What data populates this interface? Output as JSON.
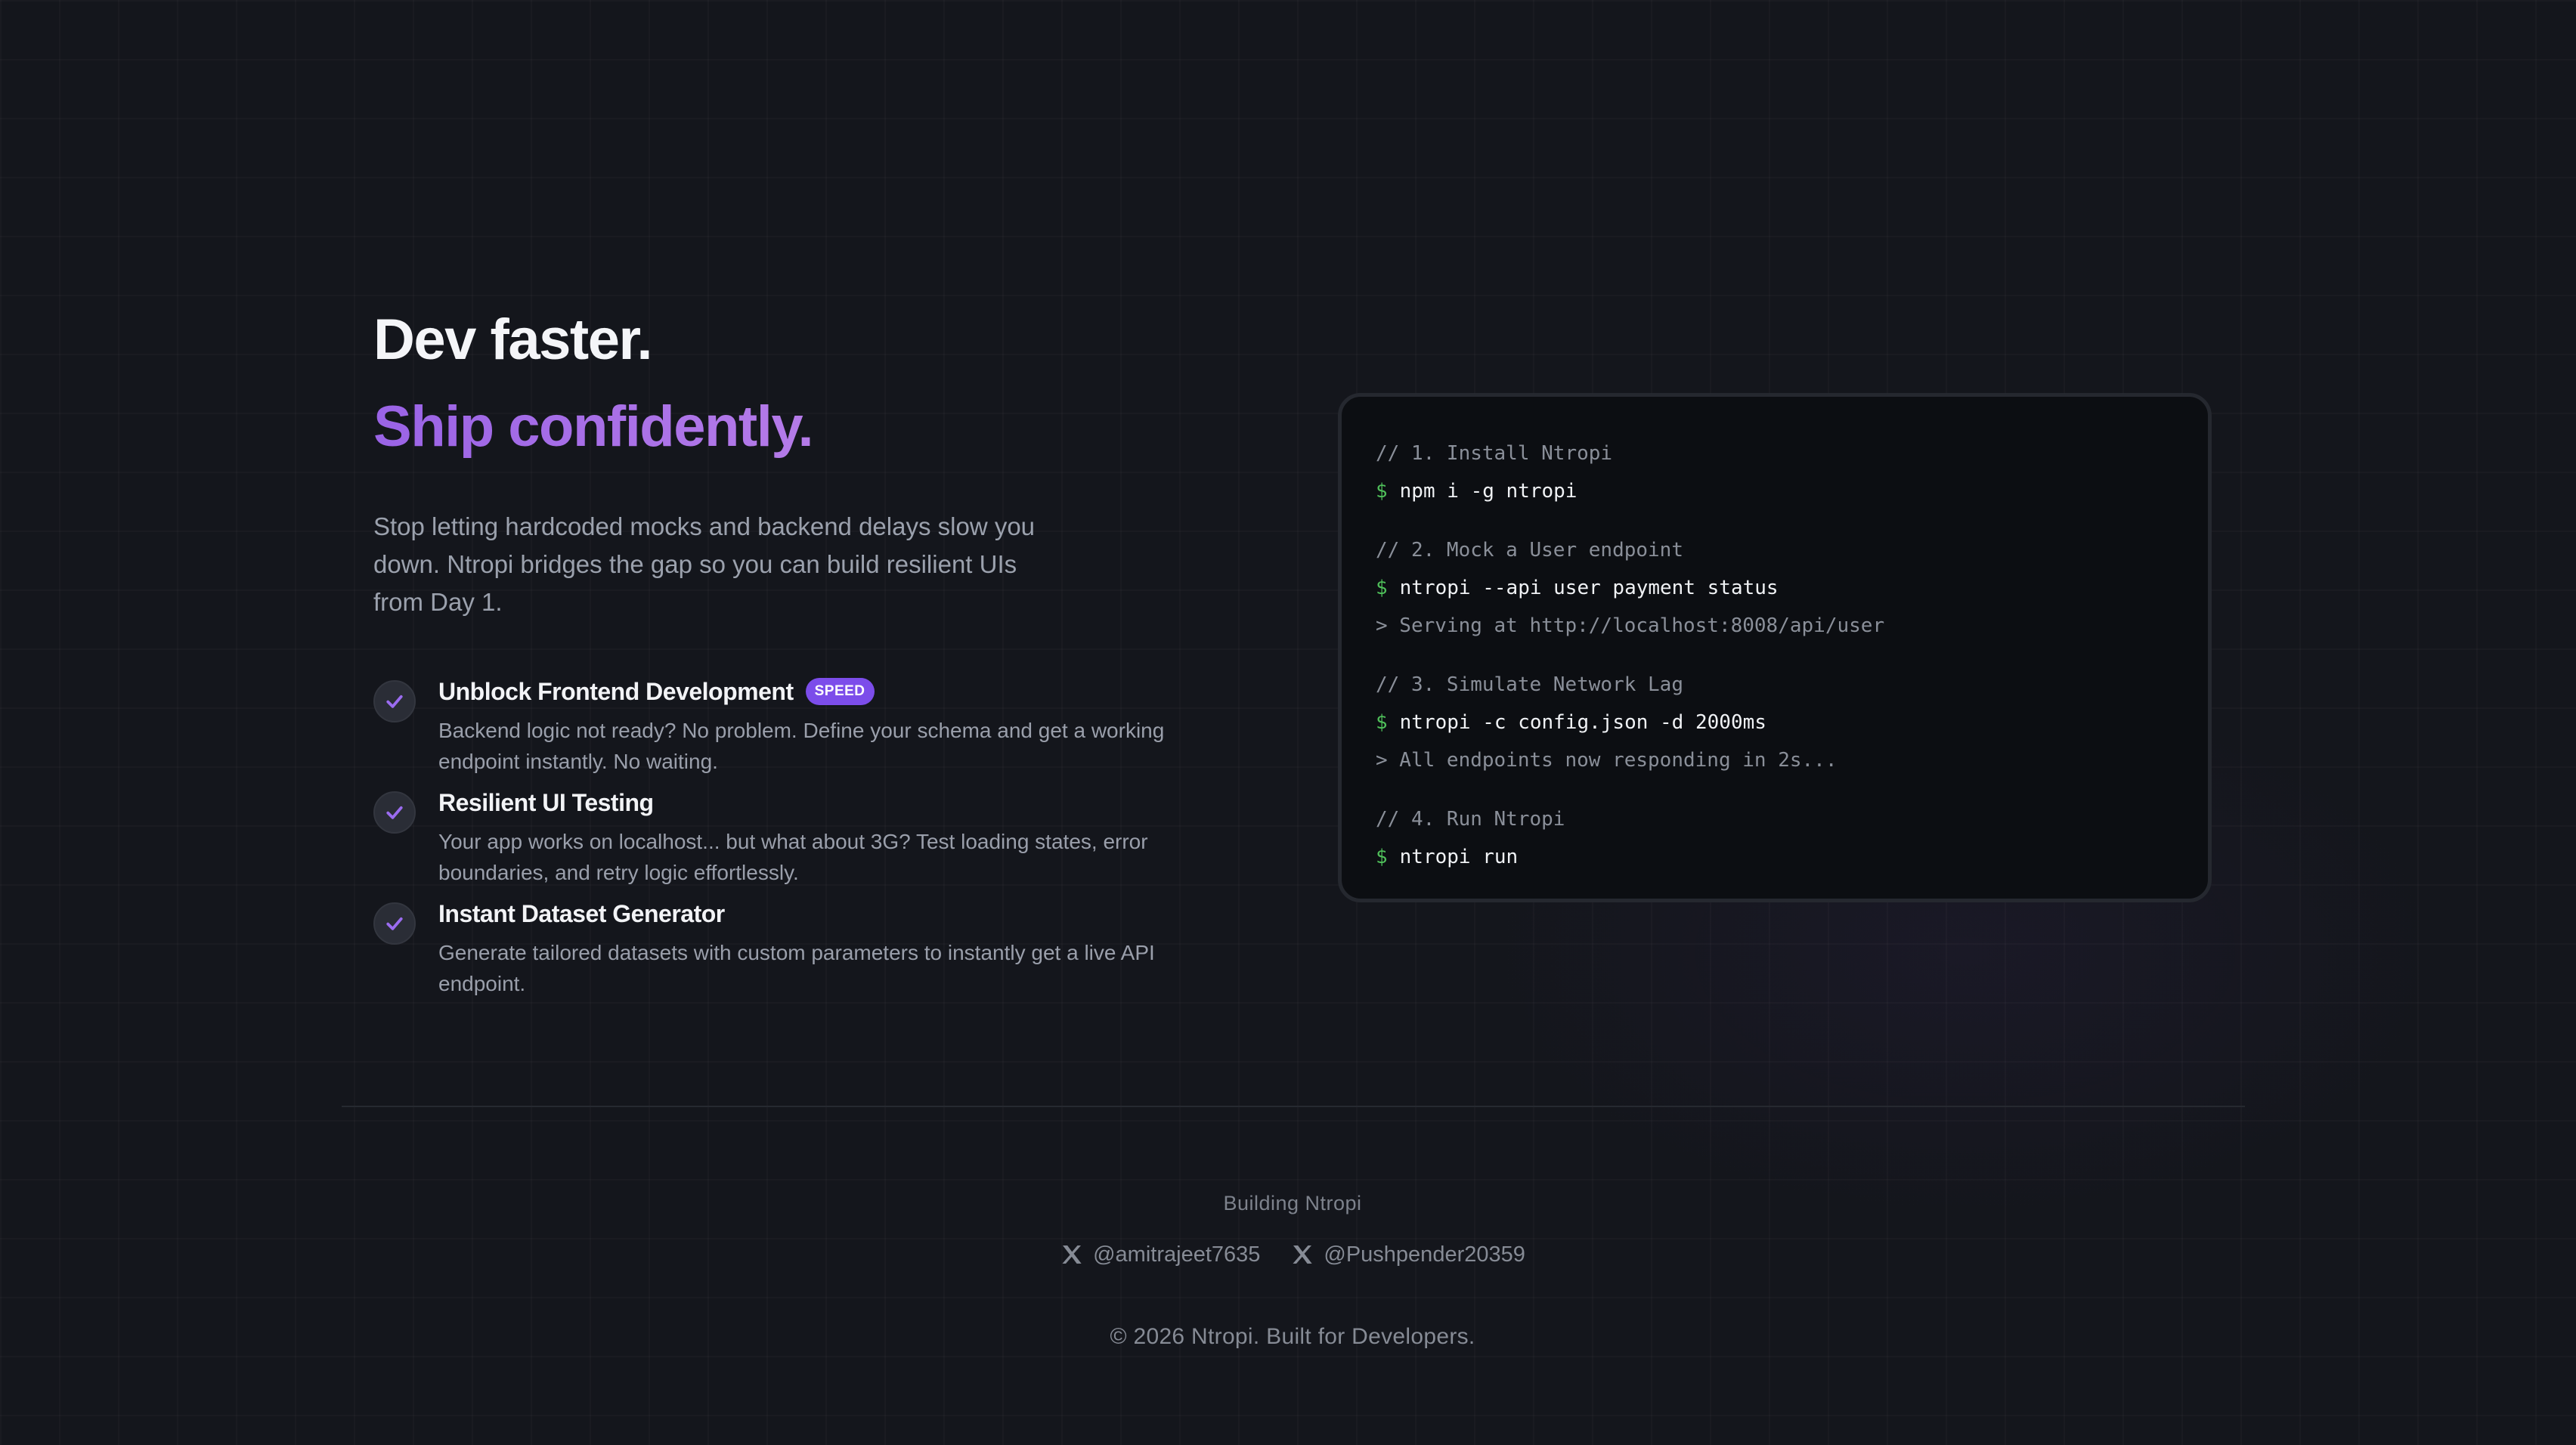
{
  "hero": {
    "title_line1": "Dev faster.",
    "title_line2": "Ship confidently.",
    "intro": "Stop letting hardcoded mocks and backend delays slow you down. Ntropi bridges the gap so you can build resilient UIs from Day 1."
  },
  "features": [
    {
      "title": "Unblock Frontend Development",
      "badge": "SPEED",
      "description": "Backend logic not ready? No problem. Define your schema and get a working endpoint instantly. No waiting.",
      "icon": "check-icon"
    },
    {
      "title": "Resilient UI Testing",
      "description": "Your app works on localhost... but what about 3G? Test loading states, error boundaries, and retry logic effortlessly.",
      "icon": "check-icon"
    },
    {
      "title": "Instant Dataset Generator",
      "description": "Generate tailored datasets with custom parameters to instantly get a live API endpoint.",
      "icon": "check-icon"
    }
  ],
  "terminal": {
    "prompt_symbol": "$",
    "steps": [
      {
        "comment": "// 1. Install Ntropi",
        "command": "npm i -g ntropi",
        "output": ""
      },
      {
        "comment": "// 2. Mock a User endpoint",
        "command": "ntropi --api user payment status",
        "output": "> Serving at http://localhost:8008/api/user"
      },
      {
        "comment": "// 3. Simulate Network Lag",
        "command": "ntropi -c config.json -d 2000ms",
        "output": "> All endpoints now responding in 2s..."
      },
      {
        "comment": "// 4. Run Ntropi",
        "command": "ntropi run",
        "output": ""
      }
    ]
  },
  "footer": {
    "heading": "Building Ntropi",
    "socials": [
      {
        "handle": "@amitrajeet7635",
        "icon": "x-logo-icon"
      },
      {
        "handle": "@Pushpender20359",
        "icon": "x-logo-icon"
      }
    ],
    "copyright": "© 2026 Ntropi. Built for Developers."
  },
  "colors": {
    "background": "#14161c",
    "accent_purple": "#9a63e6",
    "badge_purple": "#7c4dea",
    "prompt_green": "#4fbf5a"
  }
}
